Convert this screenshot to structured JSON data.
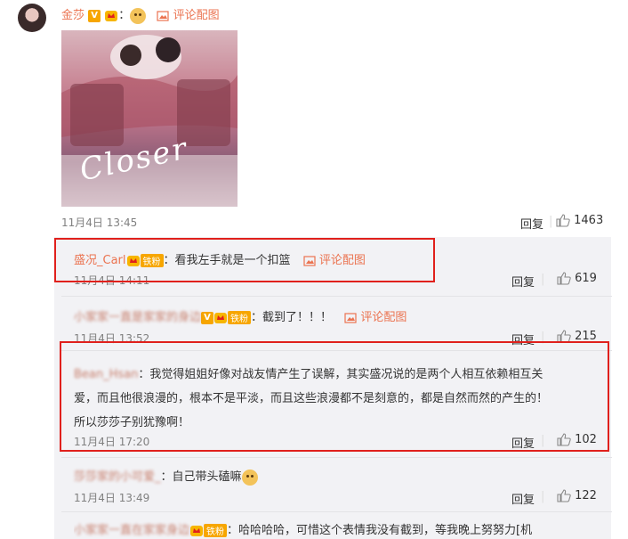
{
  "post": {
    "username": "金莎",
    "v_badge": "V",
    "colon": "：",
    "pic_link": "评论配图",
    "poster_text": "Closer",
    "timestamp": "11月4日 13:45",
    "reply_label": "回复",
    "likes": "1463"
  },
  "replies": [
    {
      "username": "盛况_Carl",
      "fan_badge": "铁粉",
      "text": "：看我左手就是一个扣篮",
      "pic_link": "评论配图",
      "timestamp": "11月4日 14:11",
      "reply_label": "回复",
      "likes": "619"
    },
    {
      "username": "小家家一直是家家的身边",
      "fan_badge": "铁粉",
      "v_badge": "V",
      "text": "：截到了！！！",
      "pic_link": "评论配图",
      "timestamp": "11月4日 13:52",
      "reply_label": "回复",
      "likes": "215"
    },
    {
      "username": "Bean_Hsan",
      "text": "：我觉得姐姐好像对战友情产生了误解，其实盛况说的是两个人相互依赖相互关",
      "text2": "爱，而且他很浪漫的，根本不是平淡，而且这些浪漫都不是刻意的，都是自然而然的产生的！",
      "text3": "所以莎莎子别犹豫啊！",
      "timestamp": "11月4日 17:20",
      "reply_label": "回复",
      "likes": "102"
    },
    {
      "username": "莎莎家的小可爱_",
      "text": "：自己带头磕嘛",
      "timestamp": "11月4日 13:49",
      "reply_label": "回复",
      "likes": "122"
    },
    {
      "username": "小家家一直在家家身边",
      "fan_badge": "铁粉",
      "text": "：哈哈哈哈，可惜这个表情我没有截到，等我晚上努努力[机"
    }
  ],
  "colors": {
    "accent": "#eb7350",
    "highlight": "#e0201c",
    "v_badge": "#f7a600"
  }
}
